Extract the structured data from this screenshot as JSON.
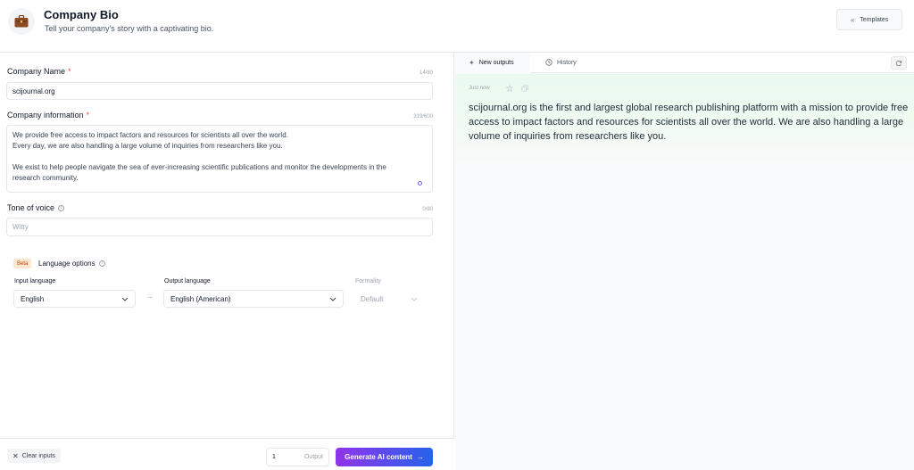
{
  "header": {
    "title": "Company Bio",
    "subtitle": "Tell your company's story with a captivating bio.",
    "templates_label": "Templates"
  },
  "form": {
    "company_name": {
      "label": "Company Name",
      "required_mark": "*",
      "counter": "14/80",
      "value": "scijournal.org"
    },
    "company_info": {
      "label": "Company information",
      "required_mark": "*",
      "counter": "319/600",
      "lines": [
        "We provide free access to impact factors and resources for scientists all over the world.",
        "Every day, we are also handling a large volume of inquiries from researchers like you.",
        "",
        "We exist to help people navigate the sea of ever-increasing scientific publications and monitor the developments in the",
        "research community."
      ]
    },
    "tone": {
      "label": "Tone of voice",
      "counter": "0/80",
      "placeholder": "Witty"
    },
    "language": {
      "badge": "Beta",
      "title": "Language options",
      "input_label": "Input language",
      "input_value": "English",
      "arrow": "→",
      "output_label": "Output language",
      "output_value": "English (American)",
      "formality_label": "Formality",
      "formality_value": "Default"
    }
  },
  "footer": {
    "clear_label": "Clear inputs",
    "output_count": "1",
    "output_label": "Output",
    "generate_label": "Generate AI content"
  },
  "results": {
    "tabs": [
      {
        "label": "New outputs",
        "active": true
      },
      {
        "label": "History",
        "active": false
      }
    ],
    "timestamp": "Just now",
    "output_text": "scijournal.org is the first and largest global research publishing platform with a mission to provide free access to impact factors and resources for scientists all over the world. We are also handling a large volume of inquiries from researchers like you."
  },
  "colors": {
    "accent_start": "#9333ea",
    "accent_end": "#2563eb",
    "required": "#ef4444",
    "output_bg": "#eafaef"
  }
}
